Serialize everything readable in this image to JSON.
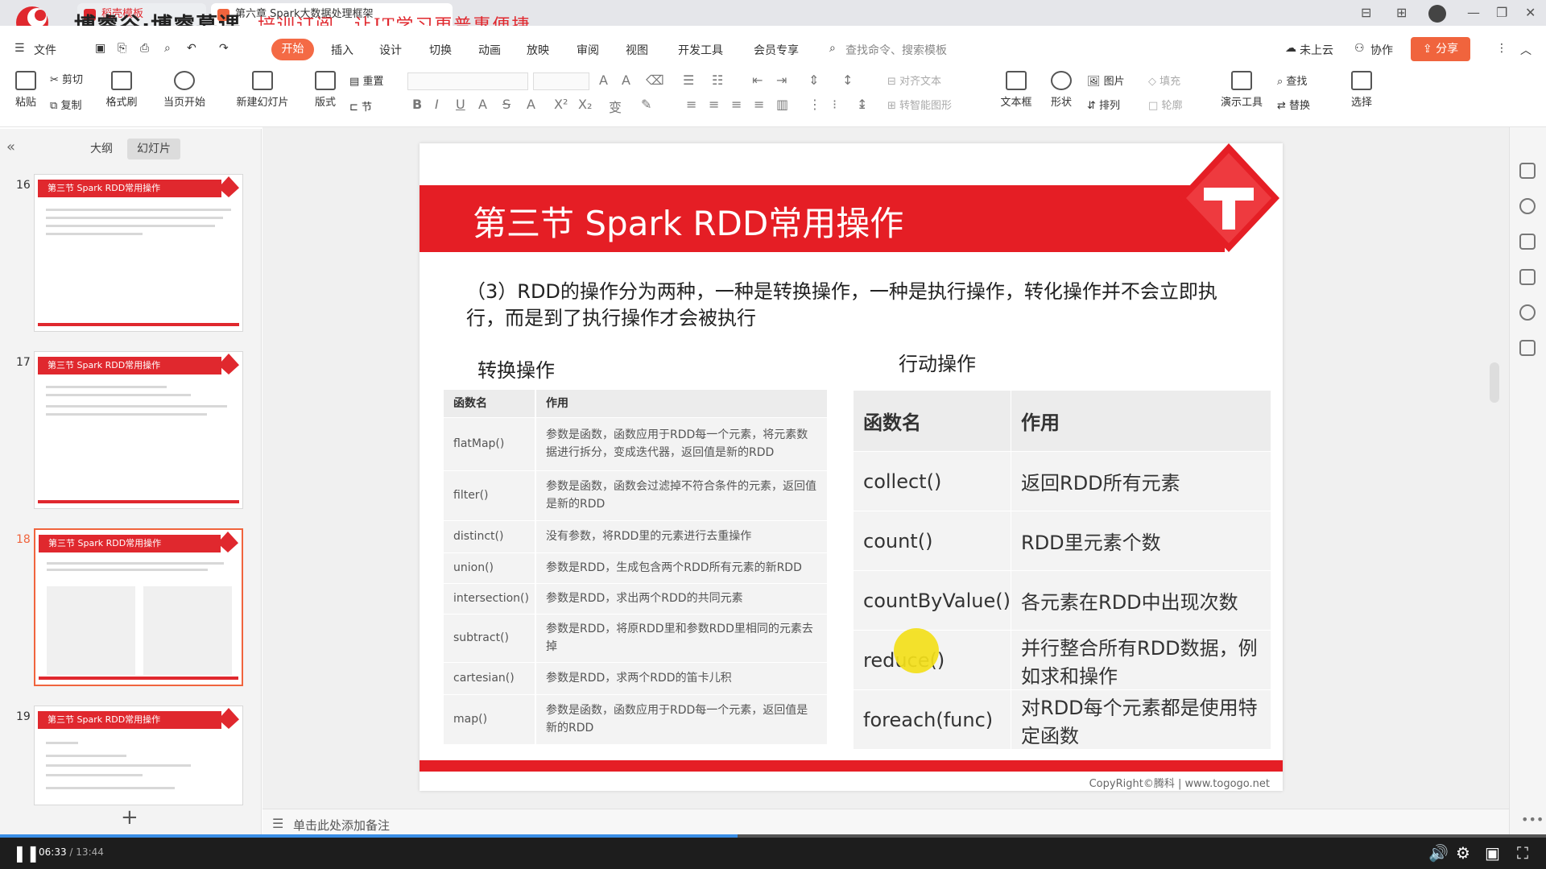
{
  "window": {
    "brand": "博睿谷·博睿慕课",
    "slogan": "培训订阅，让IT学习更普惠便捷",
    "tabs": [
      "稻壳模板",
      "第六章 Spark大数据处理框架"
    ]
  },
  "menu": {
    "file": "文件",
    "items": [
      "开始",
      "插入",
      "设计",
      "切换",
      "动画",
      "放映",
      "审阅",
      "视图",
      "开发工具",
      "会员专享"
    ],
    "active": "开始",
    "search": "查找命令、搜索模板",
    "cloud": "未上云",
    "collab": "协作",
    "share": "分享"
  },
  "ribbon": {
    "paste": "粘贴",
    "cut": "剪切",
    "copy": "复制",
    "format_painter": "格式刷",
    "start_slide": "当页开始",
    "new_slide": "新建幻灯片",
    "layout": "版式",
    "section": "节",
    "reset": "重置",
    "align_text": "对齐文本",
    "convert_smartart": "转智能图形",
    "textbox": "文本框",
    "shape": "形状",
    "arrange": "排列",
    "picture": "图片",
    "fill": "填充",
    "outline": "轮廓",
    "presenter": "演示工具",
    "find": "查找",
    "replace": "替换",
    "select": "选择"
  },
  "left_pane": {
    "tab_outline": "大纲",
    "tab_slides": "幻灯片",
    "slides": [
      {
        "num": "16",
        "title": "第三节 Spark RDD常用操作"
      },
      {
        "num": "17",
        "title": "第三节 Spark RDD常用操作"
      },
      {
        "num": "18",
        "title": "第三节 Spark RDD常用操作"
      },
      {
        "num": "19",
        "title": "第三节 Spark RDD常用操作"
      }
    ],
    "selected": "18"
  },
  "slide": {
    "title": "第三节 Spark RDD常用操作",
    "para": "（3）RDD的操作分为两种，一种是转换操作，一种是执行操作，转化操作并不会立即执行，而是到了执行操作才会被执行",
    "left_heading": "转换操作",
    "right_heading": "行动操作",
    "left_table": {
      "headers": [
        "函数名",
        "作用"
      ],
      "rows": [
        [
          "flatMap()",
          "参数是函数，函数应用于RDD每一个元素，将元素数据进行拆分，变成迭代器，返回值是新的RDD"
        ],
        [
          "filter()",
          "参数是函数，函数会过滤掉不符合条件的元素，返回值是新的RDD"
        ],
        [
          "distinct()",
          "没有参数，将RDD里的元素进行去重操作"
        ],
        [
          "union()",
          "参数是RDD，生成包含两个RDD所有元素的新RDD"
        ],
        [
          "intersection()",
          "参数是RDD，求出两个RDD的共同元素"
        ],
        [
          "subtract()",
          "参数是RDD，将原RDD里和参数RDD里相同的元素去掉"
        ],
        [
          "cartesian()",
          "参数是RDD，求两个RDD的笛卡儿积"
        ],
        [
          "map()",
          "参数是函数，函数应用于RDD每一个元素，返回值是新的RDD"
        ]
      ]
    },
    "right_table": {
      "headers": [
        "函数名",
        "作用"
      ],
      "rows": [
        [
          "collect()",
          "返回RDD所有元素"
        ],
        [
          "count()",
          "RDD里元素个数"
        ],
        [
          "countByValue()",
          "各元素在RDD中出现次数"
        ],
        [
          "reduce()",
          "并行整合所有RDD数据，例如求和操作"
        ],
        [
          "foreach(func)",
          "对RDD每个元素都是使用特定函数"
        ]
      ]
    },
    "copyright": "CopyRight©腾科 | www.togogo.net"
  },
  "notes": {
    "placeholder": "单击此处添加备注"
  },
  "player": {
    "current": "06:33",
    "total": "13:44",
    "progress_fraction": 0.477
  },
  "colors": {
    "accent": "#e51e25",
    "ribbon_active": "#f46a45",
    "player_bg": "#1d1d1d"
  }
}
